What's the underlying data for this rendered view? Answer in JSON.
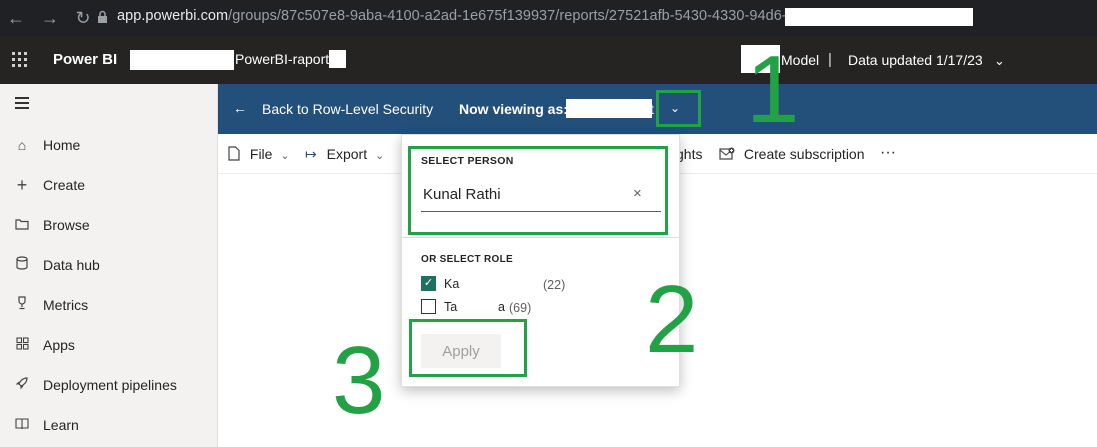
{
  "browser": {
    "url_host": "app.powerbi.com",
    "url_path": "/groups/87c507e8-9aba-4100-a2ad-1e675f139937/reports/27521afb-5430-4330-94d6-"
  },
  "header": {
    "brand": "Power BI",
    "report_name": "PowerBI-raport",
    "model": "Model",
    "separator": "|",
    "data_updated": "Data updated 1/17/23"
  },
  "leftnav": {
    "items": [
      {
        "label": "Home",
        "icon": "home-icon"
      },
      {
        "label": "Create",
        "icon": "plus-icon"
      },
      {
        "label": "Browse",
        "icon": "folder-icon"
      },
      {
        "label": "Data hub",
        "icon": "database-icon"
      },
      {
        "label": "Metrics",
        "icon": "trophy-icon"
      },
      {
        "label": "Apps",
        "icon": "apps-icon"
      },
      {
        "label": "Deployment pipelines",
        "icon": "rocket-icon"
      },
      {
        "label": "Learn",
        "icon": "book-icon"
      }
    ]
  },
  "rls_bar": {
    "back_label": "Back to Row-Level Security",
    "viewing_label": "Now viewing as:",
    "viewing_suffix": "t"
  },
  "toolbar": {
    "file": "File",
    "export": "Export",
    "insights_partial": "ghts",
    "subscription": "Create subscription",
    "more": "···"
  },
  "panel": {
    "select_person_label": "SELECT PERSON",
    "person_value": "Kunal Rathi",
    "or_select_role_label": "OR SELECT ROLE",
    "roles": [
      {
        "label": "Ka",
        "count": "(22)",
        "checked": true
      },
      {
        "label": "Ta",
        "suffix": "a",
        "count": "(69)",
        "checked": false
      }
    ],
    "apply_label": "Apply"
  },
  "annotations": {
    "one": "1",
    "two": "2",
    "three": "3",
    "color": "#22a245"
  },
  "colors": {
    "rls_bar": "#22507a",
    "header": "#252423",
    "checked": "#1e7060"
  }
}
